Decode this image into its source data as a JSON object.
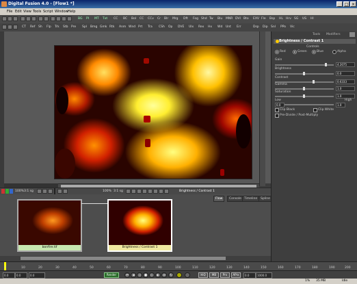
{
  "window": {
    "title": "Digital Fusion 4.0 - [Flow1 *]",
    "controls": [
      "_",
      "□",
      "×"
    ]
  },
  "menu": [
    "File",
    "Edit",
    "View",
    "Tools",
    "Script",
    "Window",
    "Help"
  ],
  "toolbar1": {
    "tools": [
      "BG",
      "PI",
      "MT",
      "Txt",
      "CC",
      "BC",
      "Bol",
      "CC",
      "CCv",
      "Cr",
      "Blr",
      "Mrg",
      "Dft",
      "Fog",
      "Shd",
      "Tw",
      "Blu",
      "MNR",
      "DVI",
      "Bto",
      "EXV",
      "Fle",
      "Bsp",
      "HL",
      "Hrv",
      "SG",
      "US",
      "Hl"
    ]
  },
  "toolbar2": {
    "tools": [
      "CT",
      "Ref",
      "Sh",
      "Flp",
      "Trk",
      "Stb",
      "Pre",
      "Spl",
      "Bmg",
      "Gmk",
      "Rtk",
      "Anm",
      "Wnd",
      "Prt",
      "Tra",
      "CSh",
      "Op",
      "DVE",
      "Ulx",
      "Rex",
      "Hx",
      "Wd",
      "Unt",
      "Err",
      "Dsp",
      "Dip",
      "Snl",
      "PPo",
      "Vic"
    ]
  },
  "viewer_bar": {
    "left_fields": [
      "100%",
      "3:1 sg",
      "100%",
      "3:1 sg"
    ],
    "node_name": "Brightness / Contrast 1"
  },
  "flow_tabs": [
    "Flow",
    "Console",
    "Timeline",
    "Spline"
  ],
  "nodes": [
    {
      "label": "bonfire.tif",
      "color": "#c8e8b0"
    },
    {
      "label": "Brightness / Contrast 1",
      "color": "#f0e8a0"
    }
  ],
  "right_panel": {
    "tabs": [
      "Tools",
      "Modifiers"
    ],
    "header": "Brightness / Contrast 1",
    "section": "Controls",
    "channels": [
      {
        "label": "Red",
        "on": true
      },
      {
        "label": "Green",
        "on": true
      },
      {
        "label": "Blue",
        "on": true
      },
      {
        "label": "Alpha",
        "on": false
      }
    ],
    "sliders": [
      {
        "label": "Gain",
        "value": "4.2075",
        "fraction": 0.88
      },
      {
        "label": "Brightness",
        "value": "0.0",
        "fraction": 0.5
      },
      {
        "label": "Contrast",
        "value": "0.6333",
        "fraction": 0.65
      },
      {
        "label": "Gamma",
        "value": "1.0",
        "fraction": 0.5
      },
      {
        "label": "Saturation",
        "value": "1.0",
        "fraction": 0.5
      }
    ],
    "low_high": {
      "low_label": "Low",
      "high_label": "High",
      "low_value": "0.0",
      "high_value": "1.0"
    },
    "checks": [
      {
        "label": "Clip Black",
        "on": false
      },
      {
        "label": "Clip White",
        "on": false
      },
      {
        "label": "Pre-Divide / Post-Multiply",
        "on": false
      }
    ]
  },
  "timeline": {
    "ticks": [
      "0",
      "10",
      "20",
      "30",
      "40",
      "50",
      "60",
      "70",
      "80",
      "90",
      "100",
      "110",
      "120",
      "130",
      "140",
      "150",
      "160",
      "170",
      "180",
      "190",
      "200"
    ]
  },
  "transport": {
    "start": "0.0",
    "current": "0.0",
    "end": "1000.0",
    "render_label": "Render",
    "hiq_label": "HiQ",
    "prx_label": "Prx",
    "mb_label": "MB",
    "aprx_label": "APrx"
  },
  "status": {
    "right1": "1%",
    "right2": "35 MB",
    "right3": "Idle"
  }
}
